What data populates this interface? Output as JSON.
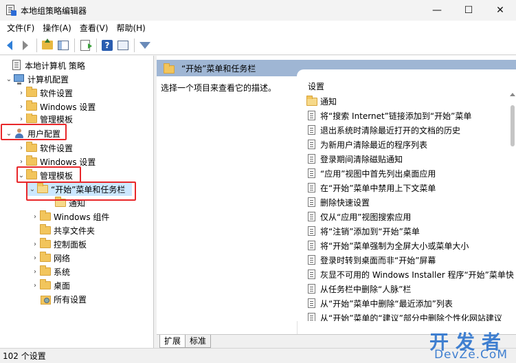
{
  "window": {
    "title": "本地组策略编辑器",
    "controls": {
      "minimize": "—",
      "maximize": "☐",
      "close": "✕"
    }
  },
  "menu": [
    "文件(F)",
    "操作(A)",
    "查看(V)",
    "帮助(H)"
  ],
  "toolbar": {
    "icons": [
      "back-arrow-icon",
      "forward-arrow-icon",
      "folder-up-icon",
      "show-hide-tree-icon",
      "export-list-icon",
      "help-icon",
      "properties-icon",
      "filter-icon"
    ],
    "help_glyph": "?"
  },
  "tree": [
    {
      "label": "本地计算机 策略",
      "chev": "",
      "icon": "doc"
    },
    {
      "label": "计算机配置",
      "chev": "⌄",
      "icon": "computer"
    },
    {
      "label": "软件设置",
      "chev": "›",
      "icon": "folder"
    },
    {
      "label": "Windows 设置",
      "chev": "›",
      "icon": "folder"
    },
    {
      "label": "管理模板",
      "chev": "›",
      "icon": "folder"
    },
    {
      "label": "用户配置",
      "chev": "⌄",
      "icon": "user"
    },
    {
      "label": "软件设置",
      "chev": "›",
      "icon": "folder"
    },
    {
      "label": "Windows 设置",
      "chev": "›",
      "icon": "folder"
    },
    {
      "label": "管理模板",
      "chev": "⌄",
      "icon": "folder"
    },
    {
      "label": "“开始”菜单和任务栏",
      "chev": "⌄",
      "icon": "folder"
    },
    {
      "label": "通知",
      "chev": "",
      "icon": "folder"
    },
    {
      "label": "Windows 组件",
      "chev": "›",
      "icon": "folder"
    },
    {
      "label": "共享文件夹",
      "chev": "",
      "icon": "folder"
    },
    {
      "label": "控制面板",
      "chev": "›",
      "icon": "folder"
    },
    {
      "label": "网络",
      "chev": "›",
      "icon": "folder"
    },
    {
      "label": "系统",
      "chev": "›",
      "icon": "folder"
    },
    {
      "label": "桌面",
      "chev": "›",
      "icon": "folder"
    },
    {
      "label": "所有设置",
      "chev": "",
      "icon": "settings"
    }
  ],
  "right": {
    "header": "“开始”菜单和任务栏",
    "description": "选择一个项目来查看它的描述。",
    "column_header": "设置",
    "items": [
      {
        "label": "通知",
        "type": "folder"
      },
      {
        "label": "将“搜索 Internet”链接添加到“开始”菜单",
        "type": "policy"
      },
      {
        "label": "退出系统时清除最近打开的文档的历史",
        "type": "policy"
      },
      {
        "label": "为新用户清除最近的程序列表",
        "type": "policy"
      },
      {
        "label": "登录期间清除磁贴通知",
        "type": "policy"
      },
      {
        "label": "“应用”视图中首先列出桌面应用",
        "type": "policy"
      },
      {
        "label": "在“开始”菜单中禁用上下文菜单",
        "type": "policy"
      },
      {
        "label": "删除快速设置",
        "type": "policy"
      },
      {
        "label": "仅从“应用”视图搜索应用",
        "type": "policy"
      },
      {
        "label": "将“注销”添加到“开始”菜单",
        "type": "policy"
      },
      {
        "label": "将“开始”菜单强制为全屏大小或菜单大小",
        "type": "policy"
      },
      {
        "label": "登录时转到桌面而非“开始”屏幕",
        "type": "policy"
      },
      {
        "label": "灰显不可用的 Windows Installer 程序“开始”菜单快",
        "type": "policy"
      },
      {
        "label": "从任务栏中删除“人脉”栏",
        "type": "policy"
      },
      {
        "label": "从“开始”菜单中删除“最近添加”列表",
        "type": "policy"
      },
      {
        "label": "从“开始”菜单的“建议”部分中删除个性化网站建议",
        "type": "policy"
      }
    ]
  },
  "tabs": [
    "扩展",
    "标准"
  ],
  "status": "102 个设置",
  "watermark": {
    "top": "开发者",
    "bottom": "DevZe.CoM"
  },
  "colors": {
    "highlight": "#e8272a",
    "header_bg": "#9fb6d4",
    "accent": "#2f7fd8"
  }
}
